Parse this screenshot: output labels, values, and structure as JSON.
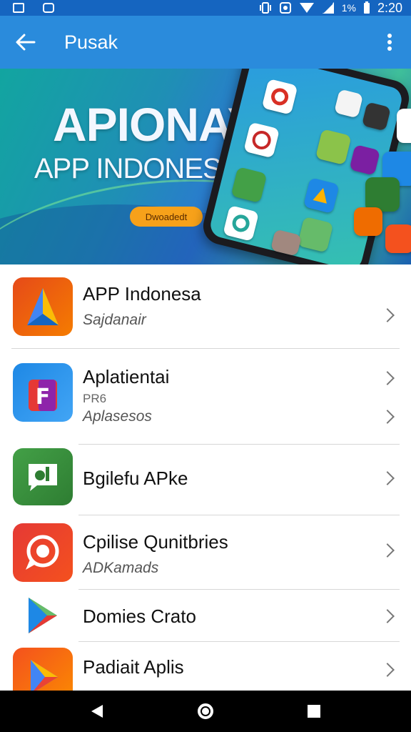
{
  "status_bar": {
    "battery_text": "1%",
    "time": "2:20"
  },
  "app_bar": {
    "title": "Pusak"
  },
  "banner": {
    "title": "APIONAY",
    "subtitle": "APP INDONESIA",
    "button_label": "Dwoadedt"
  },
  "list": [
    {
      "title": "APP Indonesa",
      "subtitle": "Sajdanair",
      "subtitle2": ""
    },
    {
      "title": "Aplatientai",
      "subtitle": "Aplasesos",
      "subtitle2": "PR6"
    },
    {
      "title": "Bgilefu APke",
      "subtitle": "",
      "subtitle2": ""
    },
    {
      "title": "Cpilise Qunitbries",
      "subtitle": "ADKamads",
      "subtitle2": ""
    },
    {
      "title": "Domies Crato",
      "subtitle": "",
      "subtitle2": ""
    },
    {
      "title": "Padiait Aplis",
      "subtitle": "",
      "subtitle2": ""
    }
  ],
  "colors": {
    "status_bar": "#1565c0",
    "app_bar": "#2a8bdc",
    "banner_button": "#f7a11a"
  },
  "icons": {
    "back": "arrow-left-icon",
    "more": "more-vert-icon",
    "nav_back": "triangle-back-icon",
    "nav_home": "circle-home-icon",
    "nav_recents": "square-recents-icon"
  }
}
